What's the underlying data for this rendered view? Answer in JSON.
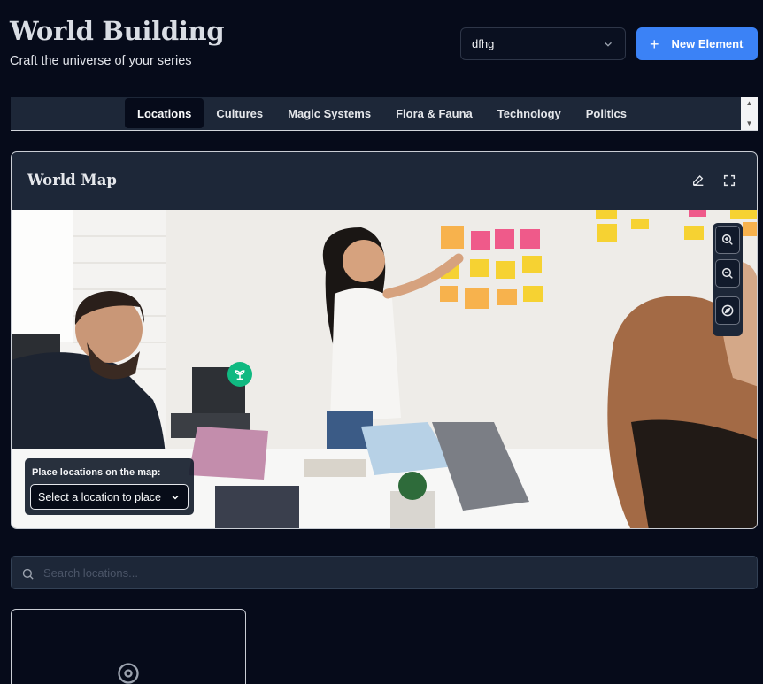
{
  "header": {
    "title": "World Building",
    "subtitle": "Craft the universe of your series",
    "series_select_value": "dfhg",
    "new_element_label": "New Element"
  },
  "tabs": [
    {
      "label": "Locations",
      "active": true
    },
    {
      "label": "Cultures",
      "active": false
    },
    {
      "label": "Magic Systems",
      "active": false
    },
    {
      "label": "Flora & Fauna",
      "active": false
    },
    {
      "label": "Technology",
      "active": false
    },
    {
      "label": "Politics",
      "active": false
    }
  ],
  "map": {
    "title": "World Map",
    "place_label": "Place locations on the map:",
    "place_select_value": "Select a location to place",
    "icons": [
      "pencil-icon",
      "fullscreen-icon",
      "zoom-in-icon",
      "zoom-out-icon",
      "compass-icon",
      "sprout-icon"
    ]
  },
  "search": {
    "placeholder": "Search locations..."
  },
  "colors": {
    "background": "#060b1a",
    "panel": "#1d2738",
    "accent": "#3b82f6",
    "pin": "#10b981"
  }
}
